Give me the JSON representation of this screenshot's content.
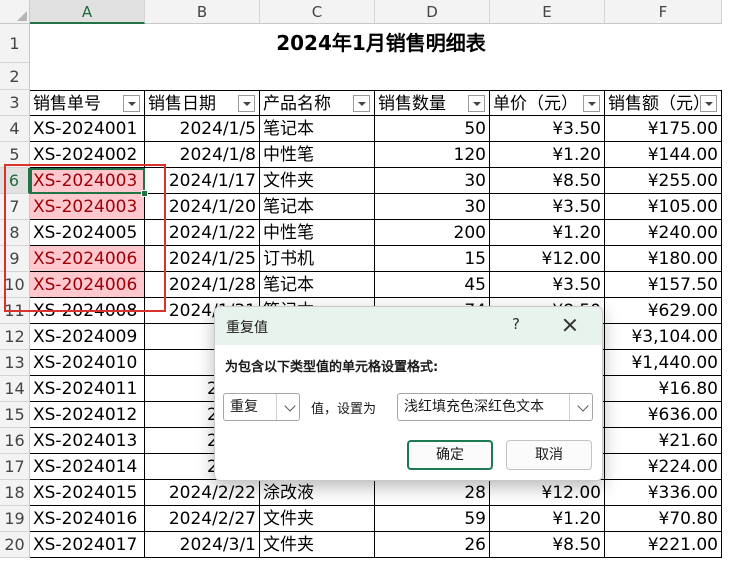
{
  "columns": [
    "A",
    "B",
    "C",
    "D",
    "E",
    "F"
  ],
  "selected_column": "A",
  "row_numbers": [
    "1",
    "2",
    "3",
    "4",
    "5",
    "6",
    "7",
    "8",
    "9",
    "10",
    "11",
    "12",
    "13",
    "14",
    "15",
    "16",
    "17",
    "18",
    "19",
    "20"
  ],
  "title": "2024年1月销售明细表",
  "headers": [
    "销售单号",
    "销售日期",
    "产品名称",
    "销售数量",
    "单价（元）",
    "销售额（元）"
  ],
  "rows": [
    {
      "row": "4",
      "id": "XS-2024001",
      "date": "2024/1/5",
      "product": "笔记本",
      "qty": "50",
      "price": "¥3.50",
      "amount": "¥175.00",
      "dup": false
    },
    {
      "row": "5",
      "id": "XS-2024002",
      "date": "2024/1/8",
      "product": "中性笔",
      "qty": "120",
      "price": "¥1.20",
      "amount": "¥144.00",
      "dup": false
    },
    {
      "row": "6",
      "id": "XS-2024003",
      "date": "2024/1/17",
      "product": "文件夹",
      "qty": "30",
      "price": "¥8.50",
      "amount": "¥255.00",
      "dup": true
    },
    {
      "row": "7",
      "id": "XS-2024003",
      "date": "2024/1/20",
      "product": "笔记本",
      "qty": "30",
      "price": "¥3.50",
      "amount": "¥105.00",
      "dup": true
    },
    {
      "row": "8",
      "id": "XS-2024005",
      "date": "2024/1/22",
      "product": "中性笔",
      "qty": "200",
      "price": "¥1.20",
      "amount": "¥240.00",
      "dup": false
    },
    {
      "row": "9",
      "id": "XS-2024006",
      "date": "2024/1/25",
      "product": "订书机",
      "qty": "15",
      "price": "¥12.00",
      "amount": "¥180.00",
      "dup": true
    },
    {
      "row": "10",
      "id": "XS-2024006",
      "date": "2024/1/28",
      "product": "笔记本",
      "qty": "45",
      "price": "¥3.50",
      "amount": "¥157.50",
      "dup": true
    },
    {
      "row": "11",
      "id": "XS-2024008",
      "date": "2024/1/31",
      "product": "笔记本",
      "qty": "74",
      "price": "¥8.50",
      "amount": "¥629.00",
      "dup": false
    },
    {
      "row": "12",
      "id": "XS-2024009",
      "date": "2024",
      "product": "",
      "qty": "",
      "price": "",
      "amount": "¥3,104.00",
      "dup": false
    },
    {
      "row": "13",
      "id": "XS-2024010",
      "date": "2024",
      "product": "",
      "qty": "",
      "price": "",
      "amount": "¥1,440.00",
      "dup": false
    },
    {
      "row": "14",
      "id": "XS-2024011",
      "date": "2024/",
      "product": "",
      "qty": "",
      "price": "",
      "amount": "¥16.80",
      "dup": false
    },
    {
      "row": "15",
      "id": "XS-2024012",
      "date": "2024/",
      "product": "",
      "qty": "",
      "price": "",
      "amount": "¥636.00",
      "dup": false
    },
    {
      "row": "16",
      "id": "XS-2024013",
      "date": "2024/",
      "product": "",
      "qty": "",
      "price": "",
      "amount": "¥21.60",
      "dup": false
    },
    {
      "row": "17",
      "id": "XS-2024014",
      "date": "2024/",
      "product": "",
      "qty": "",
      "price": "",
      "amount": "¥224.00",
      "dup": false
    },
    {
      "row": "18",
      "id": "XS-2024015",
      "date": "2024/2/22",
      "product": "涂改液",
      "qty": "28",
      "price": "¥12.00",
      "amount": "¥336.00",
      "dup": false
    },
    {
      "row": "19",
      "id": "XS-2024016",
      "date": "2024/2/27",
      "product": "文件夹",
      "qty": "59",
      "price": "¥1.20",
      "amount": "¥70.80",
      "dup": false
    },
    {
      "row": "20",
      "id": "XS-2024017",
      "date": "2024/3/1",
      "product": "文件夹",
      "qty": "26",
      "price": "¥8.50",
      "amount": "¥221.00",
      "dup": false
    }
  ],
  "dialog": {
    "title": "重复值",
    "help": "?",
    "prompt": "为包含以下类型值的单元格设置格式:",
    "type_value": "重复",
    "middle_text": "值，设置为",
    "format_value": "浅红填充色深红色文本",
    "ok": "确定",
    "cancel": "取消"
  },
  "colors": {
    "dup_fill": "#ffc7ce",
    "dup_text": "#9c0006",
    "excel_green": "#217346",
    "annotation_red": "#d9342b",
    "dialog_title_bg": "#e8f3ed"
  }
}
